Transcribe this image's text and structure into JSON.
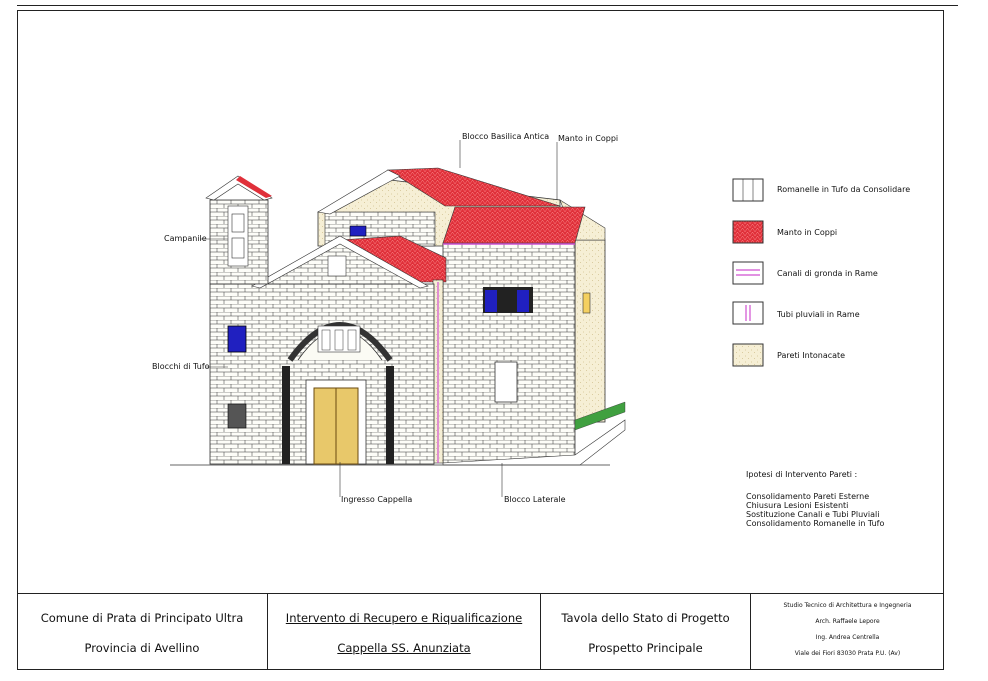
{
  "drawing": {
    "labels": {
      "blocco_basilica": "Blocco Basilica Antica",
      "manto_coppi": "Manto in Coppi",
      "campanile": "Campanile",
      "blocchi_tufo": "Blocchi di Tufo",
      "ingresso": "Ingresso Cappella",
      "blocco_laterale": "Blocco Laterale"
    }
  },
  "legend": [
    {
      "label": "Romanelle in Tufo da Consolidare",
      "swatch": "romanelle"
    },
    {
      "label": "Manto in Coppi",
      "swatch": "coppi"
    },
    {
      "label": "Canali di gronda in Rame",
      "swatch": "canali"
    },
    {
      "label": "Tubi pluviali in Rame",
      "swatch": "tubi"
    },
    {
      "label": "Pareti Intonacate",
      "swatch": "intonaco"
    }
  ],
  "notes": {
    "title": "Ipotesi di Intervento Pareti :",
    "items": [
      "Consolidamento Pareti Esterne",
      "Chiusura Lesioni Esistenti",
      "Sostituzione Canali e Tubi Pluviali",
      "Consolidamento Romanelle in Tufo"
    ]
  },
  "titleblock": {
    "comune": "Comune di Prata di Principato Ultra",
    "provincia": "Provincia di Avellino",
    "intervento": "Intervento di Recupero e Riqualificazione",
    "cappella": "Cappella SS. Anunziata",
    "tavola": "Tavola dello Stato di Progetto",
    "prospetto": "Prospetto Principale",
    "studio": {
      "name": "Studio Tecnico di Architettura e Ingegneria",
      "arch": "Arch. Raffaele Lepore",
      "ing": "Ing. Andrea Centrella",
      "address": "Viale dei Fiori 83030 Prata P.U. (Av)"
    }
  },
  "colors": {
    "roof": "#e0303a",
    "gutter": "#d050d0",
    "window": "#2020c0",
    "plaster": "#f4ecd0",
    "tufo": "#fbfbf4"
  }
}
